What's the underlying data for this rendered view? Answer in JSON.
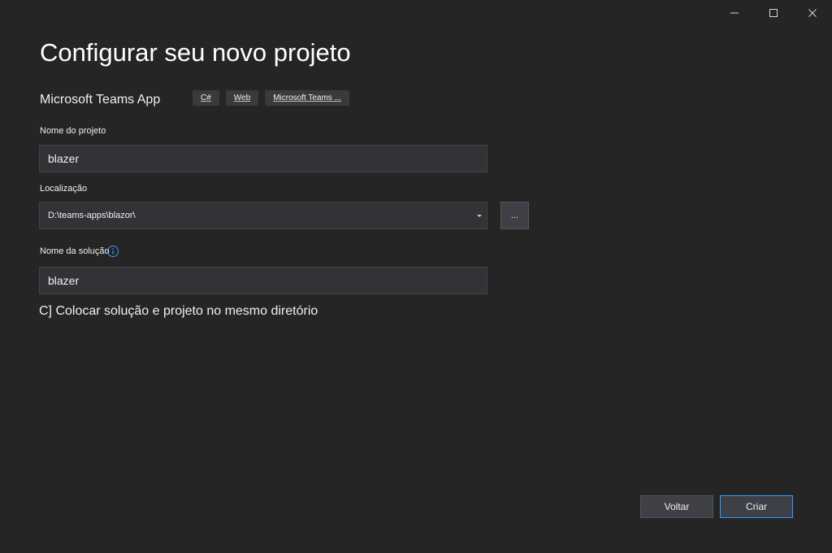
{
  "window": {
    "title": "Configurar seu novo projeto"
  },
  "template": {
    "name": "Microsoft Teams App",
    "tags": [
      "C#",
      "Web",
      "Microsoft Teams ..."
    ]
  },
  "project_name": {
    "label": "Nome do projeto",
    "value": "blazer"
  },
  "location": {
    "label": "Localização",
    "value": "D:\\teams-apps\\blazor\\",
    "browse_label": "..."
  },
  "solution_name": {
    "label": "Nome da solução",
    "value": "blazer"
  },
  "same_directory": {
    "label": "C] Colocar solução e projeto no mesmo diretório"
  },
  "footer": {
    "back_label": "Voltar",
    "create_label": "Criar"
  },
  "colors": {
    "background": "#252526",
    "accent": "#3399ff"
  },
  "icons": [
    "minimize-icon",
    "maximize-icon",
    "close-icon",
    "info-icon",
    "dropdown-arrow-icon"
  ]
}
